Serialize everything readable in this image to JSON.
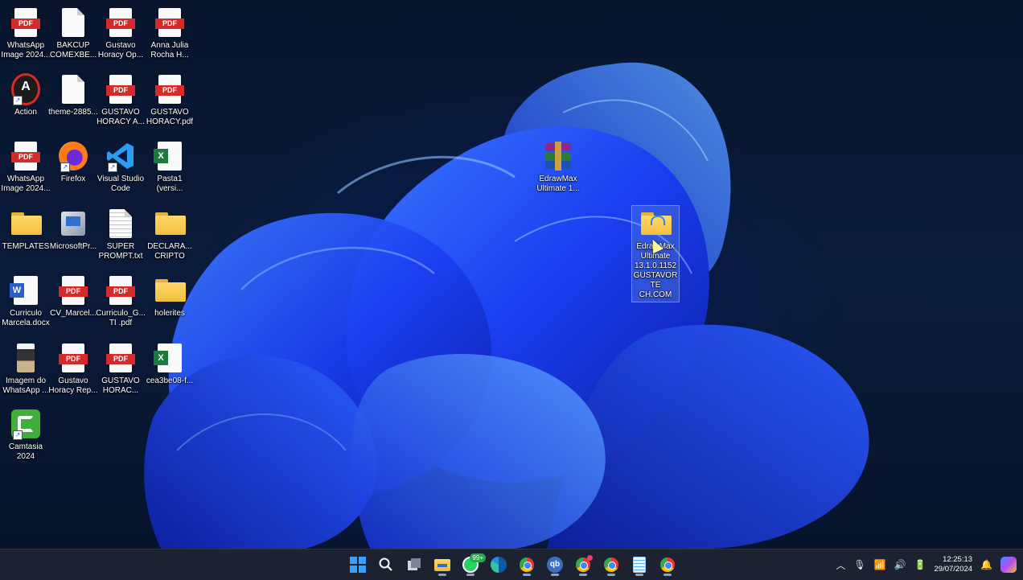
{
  "desktop": {
    "icons": [
      {
        "label": "WhatsApp Image 2024...",
        "type": "pdf"
      },
      {
        "label": "BAKCUP COMEXBE...",
        "type": "page"
      },
      {
        "label": "Gustavo Horacy Op...",
        "type": "pdf"
      },
      {
        "label": "Anna Julia Rocha H...",
        "type": "pdf"
      },
      {
        "label": "Action",
        "type": "app"
      },
      {
        "label": "theme-2885...",
        "type": "page"
      },
      {
        "label": "GUSTAVO HORACY A...",
        "type": "pdf"
      },
      {
        "label": "GUSTAVO HORACY.pdf",
        "type": "pdf"
      },
      {
        "label": "WhatsApp Image 2024...",
        "type": "pdf"
      },
      {
        "label": "Firefox",
        "type": "app"
      },
      {
        "label": "Visual Studio Code",
        "type": "app"
      },
      {
        "label": "Pasta1 (versi...",
        "type": "xls"
      },
      {
        "label": "TEMPLATES",
        "type": "folder"
      },
      {
        "label": "MicrosoftPr...",
        "type": "app"
      },
      {
        "label": "SUPER PROMPT.txt",
        "type": "page"
      },
      {
        "label": "DECLARA... CRIPTO",
        "type": "folder"
      },
      {
        "label": "Curriculo Marcela.docx",
        "type": "doc"
      },
      {
        "label": "CV_Marcel...",
        "type": "pdf"
      },
      {
        "label": "Curriculo_G... TI .pdf",
        "type": "pdf"
      },
      {
        "label": "holerites",
        "type": "folder"
      },
      {
        "label": "Imagem do WhatsApp ...",
        "type": "image"
      },
      {
        "label": "Gustavo Horacy Rep...",
        "type": "pdf"
      },
      {
        "label": "GUSTAVO HORAC...",
        "type": "pdf"
      },
      {
        "label": "cea3be08-f...",
        "type": "xls"
      },
      {
        "label": "Camtasia 2024",
        "type": "app"
      }
    ],
    "floating": {
      "winrar": {
        "label": "EdrawMax Ultimate 1..."
      },
      "folder": {
        "label": "EdrawMax Ultimate 13.1.0.1152 GUSTAVORTE CH.COM"
      }
    },
    "pdf_badge": "PDF"
  },
  "taskbar": {
    "whatsapp_badge": "99+",
    "clock": {
      "time": "12:25:13",
      "date": "29/07/2024"
    }
  }
}
